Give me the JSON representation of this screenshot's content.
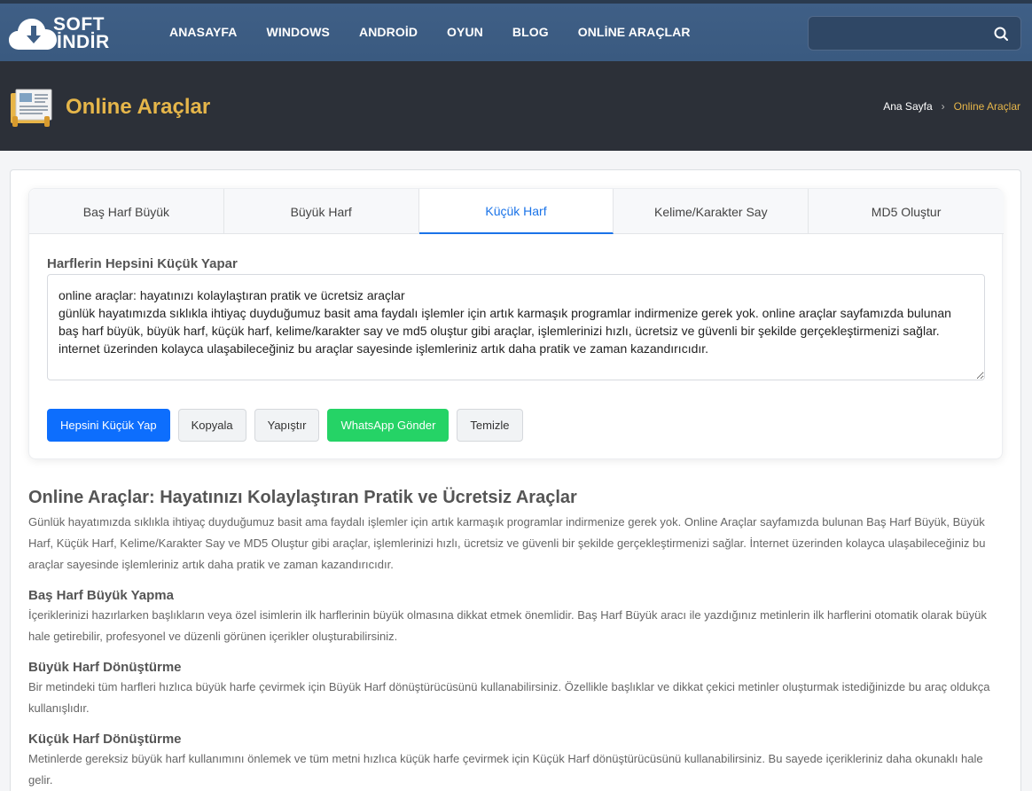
{
  "logo": {
    "line1": "SOFT",
    "line2": "İNDİR"
  },
  "nav": {
    "items": [
      "ANASAYFA",
      "WINDOWS",
      "ANDROİD",
      "OYUN",
      "BLOG",
      "ONLİNE ARAÇLAR"
    ]
  },
  "search": {
    "value": "",
    "placeholder": ""
  },
  "header": {
    "title": "Online Araçlar",
    "breadcrumb": {
      "home": "Ana Sayfa",
      "separator": "›",
      "current": "Online Araçlar"
    }
  },
  "tool": {
    "tabs": [
      "Baş Harf Büyük",
      "Büyük Harf",
      "Küçük Harf",
      "Kelime/Karakter Say",
      "MD5 Oluştur"
    ],
    "active_tab": 2,
    "heading": "Harflerin Hepsini Küçük Yapar",
    "textarea_value": "online araçlar: hayatınızı kolaylaştıran pratik ve ücretsiz araçlar\ngünlük hayatımızda sıklıkla ihtiyaç duyduğumuz basit ama faydalı işlemler için artık karmaşık programlar indirmenize gerek yok. online araçlar sayfamızda bulunan baş harf büyük, büyük harf, küçük harf, kelime/karakter say ve md5 oluştur gibi araçlar, işlemlerinizi hızlı, ücretsiz ve güvenli bir şekilde gerçekleştirmenizi sağlar. internet üzerinden kolayca ulaşabileceğiniz bu araçlar sayesinde işlemleriniz artık daha pratik ve zaman kazandırıcıdır.",
    "buttons": {
      "convert": "Hepsini Küçük Yap",
      "copy": "Kopyala",
      "paste": "Yapıştır",
      "whatsapp": "WhatsApp Gönder",
      "clear": "Temizle"
    }
  },
  "article": {
    "title": "Online Araçlar: Hayatınızı Kolaylaştıran Pratik ve Ücretsiz Araçlar",
    "intro": "Günlük hayatımızda sıklıkla ihtiyaç duyduğumuz basit ama faydalı işlemler için artık karmaşık programlar indirmenize gerek yok. Online Araçlar sayfamızda bulunan Baş Harf Büyük, Büyük Harf, Küçük Harf, Kelime/Karakter Say ve MD5 Oluştur gibi araçlar, işlemlerinizi hızlı, ücretsiz ve güvenli bir şekilde gerçekleştirmenizi sağlar. İnternet üzerinden kolayca ulaşabileceğiniz bu araçlar sayesinde işlemleriniz artık daha pratik ve zaman kazandırıcıdır.",
    "sections": [
      {
        "heading": "Baş Harf Büyük Yapma",
        "text": "İçeriklerinizi hazırlarken başlıkların veya özel isimlerin ilk harflerinin büyük olmasına dikkat etmek önemlidir. Baş Harf Büyük aracı ile yazdığınız metinlerin ilk harflerini otomatik olarak büyük hale getirebilir, profesyonel ve düzenli görünen içerikler oluşturabilirsiniz."
      },
      {
        "heading": "Büyük Harf Dönüştürme",
        "text": "Bir metindeki tüm harfleri hızlıca büyük harfe çevirmek için Büyük Harf dönüştürücüsünü kullanabilirsiniz. Özellikle başlıklar ve dikkat çekici metinler oluşturmak istediğinizde bu araç oldukça kullanışlıdır."
      },
      {
        "heading": "Küçük Harf Dönüştürme",
        "text": "Metinlerde gereksiz büyük harf kullanımını önlemek ve tüm metni hızlıca küçük harfe çevirmek için Küçük Harf dönüştürücüsünü kullanabilirsiniz. Bu sayede içerikleriniz daha okunaklı hale gelir."
      }
    ]
  }
}
